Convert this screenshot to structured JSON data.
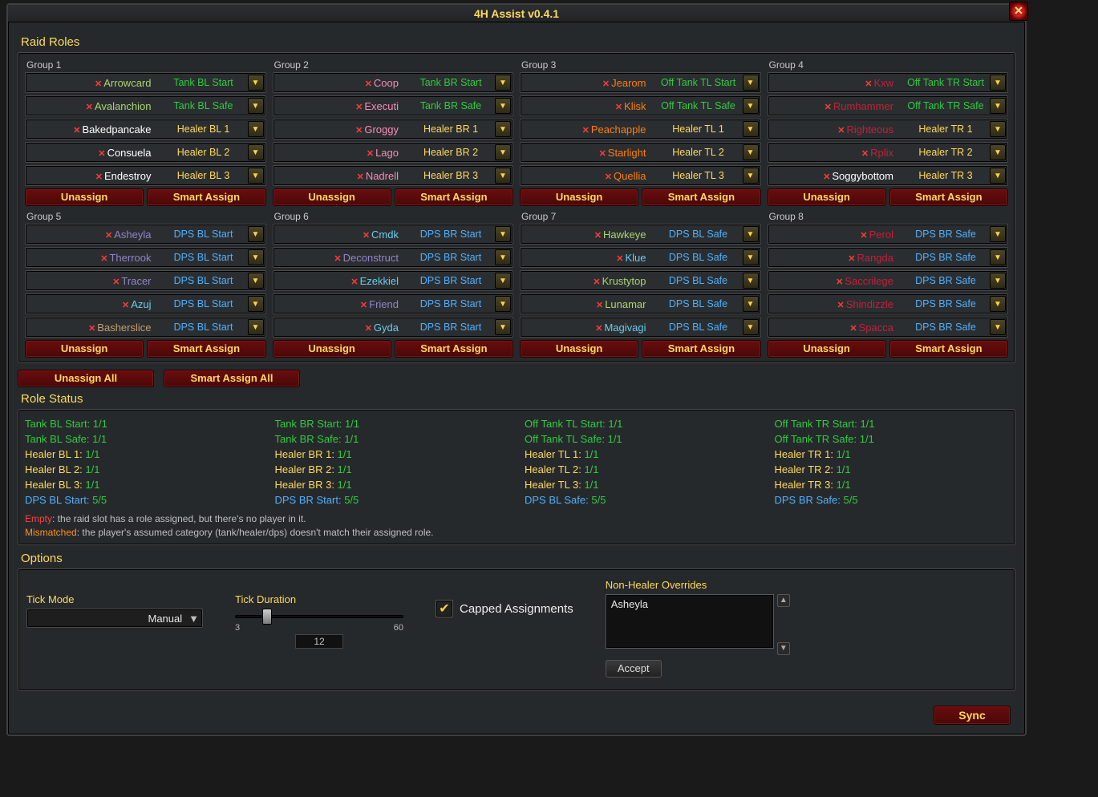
{
  "title": "4H Assist v0.4.1",
  "section_raid_roles": "Raid Roles",
  "section_role_status": "Role Status",
  "section_options": "Options",
  "btn_unassign": "Unassign",
  "btn_smart_assign": "Smart Assign",
  "btn_unassign_all": "Unassign All",
  "btn_smart_assign_all": "Smart Assign All",
  "btn_sync": "Sync",
  "btn_accept": "Accept",
  "groups": [
    {
      "label": "Group 1",
      "players": [
        {
          "name": "Arrowcard",
          "class": "hunter",
          "role": "Tank BL Start",
          "rclass": "tank"
        },
        {
          "name": "Avalanchion",
          "class": "hunter",
          "role": "Tank BL Safe",
          "rclass": "tank"
        },
        {
          "name": "Bakedpancake",
          "class": "priest",
          "role": "Healer BL 1",
          "rclass": "healer"
        },
        {
          "name": "Consuela",
          "class": "priest",
          "role": "Healer BL 2",
          "rclass": "healer"
        },
        {
          "name": "Endestroy",
          "class": "priest",
          "role": "Healer BL 3",
          "rclass": "healer"
        }
      ]
    },
    {
      "label": "Group 2",
      "players": [
        {
          "name": "Coop",
          "class": "paladin",
          "role": "Tank BR Start",
          "rclass": "tank"
        },
        {
          "name": "Executi",
          "class": "paladin",
          "role": "Tank BR Safe",
          "rclass": "tank"
        },
        {
          "name": "Groggy",
          "class": "paladin",
          "role": "Healer BR 1",
          "rclass": "healer"
        },
        {
          "name": "Lago",
          "class": "paladin",
          "role": "Healer BR 2",
          "rclass": "healer"
        },
        {
          "name": "Nadrell",
          "class": "paladin",
          "role": "Healer BR 3",
          "rclass": "healer"
        }
      ]
    },
    {
      "label": "Group 3",
      "players": [
        {
          "name": "Jearom",
          "class": "druid",
          "role": "Off Tank TL Start",
          "rclass": "tank"
        },
        {
          "name": "Klisk",
          "class": "druid",
          "role": "Off Tank TL Safe",
          "rclass": "tank"
        },
        {
          "name": "Peachapple",
          "class": "druid",
          "role": "Healer TL 1",
          "rclass": "healer"
        },
        {
          "name": "Starlight",
          "class": "druid",
          "role": "Healer TL 2",
          "rclass": "healer"
        },
        {
          "name": "Quellia",
          "class": "druid",
          "role": "Healer TL 3",
          "rclass": "healer"
        }
      ]
    },
    {
      "label": "Group 4",
      "players": [
        {
          "name": "Kxw",
          "class": "dk",
          "role": "Off Tank TR Start",
          "rclass": "tank"
        },
        {
          "name": "Rumhammer",
          "class": "dk",
          "role": "Off Tank TR Safe",
          "rclass": "tank"
        },
        {
          "name": "Righteous",
          "class": "dk",
          "role": "Healer TR 1",
          "rclass": "healer"
        },
        {
          "name": "Rplix",
          "class": "dk",
          "role": "Healer TR 2",
          "rclass": "healer"
        },
        {
          "name": "Soggybottom",
          "class": "priest",
          "role": "Healer TR 3",
          "rclass": "healer"
        }
      ]
    },
    {
      "label": "Group 5",
      "players": [
        {
          "name": "Asheyla",
          "class": "warlock",
          "role": "DPS BL Start",
          "rclass": "dps"
        },
        {
          "name": "Therrook",
          "class": "warlock",
          "role": "DPS BL Start",
          "rclass": "dps"
        },
        {
          "name": "Tracer",
          "class": "warlock",
          "role": "DPS BL Start",
          "rclass": "dps"
        },
        {
          "name": "Azuj",
          "class": "mage",
          "role": "DPS BL Start",
          "rclass": "dps"
        },
        {
          "name": "Basherslice",
          "class": "warrior",
          "role": "DPS BL Start",
          "rclass": "dps"
        }
      ]
    },
    {
      "label": "Group 6",
      "players": [
        {
          "name": "Cmdk",
          "class": "mage",
          "role": "DPS BR Start",
          "rclass": "dps"
        },
        {
          "name": "Deconstruct",
          "class": "warlock",
          "role": "DPS BR Start",
          "rclass": "dps"
        },
        {
          "name": "Ezekkiel",
          "class": "mage",
          "role": "DPS BR Start",
          "rclass": "dps"
        },
        {
          "name": "Friend",
          "class": "warlock",
          "role": "DPS BR Start",
          "rclass": "dps"
        },
        {
          "name": "Gyda",
          "class": "mage",
          "role": "DPS BR Start",
          "rclass": "dps"
        }
      ]
    },
    {
      "label": "Group 7",
      "players": [
        {
          "name": "Hawkeye",
          "class": "hunter",
          "role": "DPS BL Safe",
          "rclass": "dps"
        },
        {
          "name": "Klue",
          "class": "mage",
          "role": "DPS BL Safe",
          "rclass": "dps"
        },
        {
          "name": "Krustytop",
          "class": "hunter",
          "role": "DPS BL Safe",
          "rclass": "dps"
        },
        {
          "name": "Lunamar",
          "class": "hunter",
          "role": "DPS BL Safe",
          "rclass": "dps"
        },
        {
          "name": "Magivagi",
          "class": "mage",
          "role": "DPS BL Safe",
          "rclass": "dps"
        }
      ]
    },
    {
      "label": "Group 8",
      "players": [
        {
          "name": "Perol",
          "class": "dk",
          "role": "DPS BR Safe",
          "rclass": "dps"
        },
        {
          "name": "Rangda",
          "class": "dk",
          "role": "DPS BR Safe",
          "rclass": "dps"
        },
        {
          "name": "Saccrilege",
          "class": "dk",
          "role": "DPS BR Safe",
          "rclass": "dps"
        },
        {
          "name": "Shindizzle",
          "class": "dk",
          "role": "DPS BR Safe",
          "rclass": "dps"
        },
        {
          "name": "Spacca",
          "class": "dk",
          "role": "DPS BR Safe",
          "rclass": "dps"
        }
      ]
    }
  ],
  "status_cols": [
    [
      {
        "label": "Tank BL Start",
        "val": "1/1",
        "lc": "r-tank",
        "vc": "r-tank"
      },
      {
        "label": "Tank BL Safe",
        "val": "1/1",
        "lc": "r-tank",
        "vc": "r-tank"
      },
      {
        "label": "Healer BL 1",
        "val": "1/1",
        "lc": "r-healer",
        "vc": "r-tank"
      },
      {
        "label": "Healer BL 2",
        "val": "1/1",
        "lc": "r-healer",
        "vc": "r-tank"
      },
      {
        "label": "Healer BL 3",
        "val": "1/1",
        "lc": "r-healer",
        "vc": "r-tank"
      },
      {
        "label": "DPS BL Start",
        "val": "5/5",
        "lc": "r-dps",
        "vc": "r-tank"
      }
    ],
    [
      {
        "label": "Tank BR Start",
        "val": "1/1",
        "lc": "r-tank",
        "vc": "r-tank"
      },
      {
        "label": "Tank BR Safe",
        "val": "1/1",
        "lc": "r-tank",
        "vc": "r-tank"
      },
      {
        "label": "Healer BR 1",
        "val": "1/1",
        "lc": "r-healer",
        "vc": "r-tank"
      },
      {
        "label": "Healer BR 2",
        "val": "1/1",
        "lc": "r-healer",
        "vc": "r-tank"
      },
      {
        "label": "Healer BR 3",
        "val": "1/1",
        "lc": "r-healer",
        "vc": "r-tank"
      },
      {
        "label": "DPS BR Start",
        "val": "5/5",
        "lc": "r-dps",
        "vc": "r-tank"
      }
    ],
    [
      {
        "label": "Off Tank TL Start",
        "val": "1/1",
        "lc": "r-tank",
        "vc": "r-tank"
      },
      {
        "label": "Off Tank TL Safe",
        "val": "1/1",
        "lc": "r-tank",
        "vc": "r-tank"
      },
      {
        "label": "Healer TL 1",
        "val": "1/1",
        "lc": "r-healer",
        "vc": "r-tank"
      },
      {
        "label": "Healer TL 2",
        "val": "1/1",
        "lc": "r-healer",
        "vc": "r-tank"
      },
      {
        "label": "Healer TL 3",
        "val": "1/1",
        "lc": "r-healer",
        "vc": "r-tank"
      },
      {
        "label": "DPS BL Safe",
        "val": "5/5",
        "lc": "r-dps",
        "vc": "r-tank"
      }
    ],
    [
      {
        "label": "Off Tank TR Start",
        "val": "1/1",
        "lc": "r-tank",
        "vc": "r-tank"
      },
      {
        "label": "Off Tank TR Safe",
        "val": "1/1",
        "lc": "r-tank",
        "vc": "r-tank"
      },
      {
        "label": "Healer TR 1",
        "val": "1/1",
        "lc": "r-healer",
        "vc": "r-tank"
      },
      {
        "label": "Healer TR 2",
        "val": "1/1",
        "lc": "r-healer",
        "vc": "r-tank"
      },
      {
        "label": "Healer TR 3",
        "val": "1/1",
        "lc": "r-healer",
        "vc": "r-tank"
      },
      {
        "label": "DPS BR Safe",
        "val": "5/5",
        "lc": "r-dps",
        "vc": "r-tank"
      }
    ]
  ],
  "legend_empty_key": "Empty",
  "legend_empty_text": ": the raid slot has a role assigned, but there's no player in it.",
  "legend_mismatch_key": "Mismatched",
  "legend_mismatch_text": ": the player's assumed category (tank/healer/dps) doesn't match their assigned role.",
  "options": {
    "tick_mode_label": "Tick Mode",
    "tick_mode_value": "Manual",
    "tick_duration_label": "Tick Duration",
    "tick_duration_min": "3",
    "tick_duration_max": "60",
    "tick_duration_value": "12",
    "capped_label": "Capped Assignments",
    "capped_checked": true,
    "overrides_label": "Non-Healer Overrides",
    "overrides_value": "Asheyla"
  }
}
